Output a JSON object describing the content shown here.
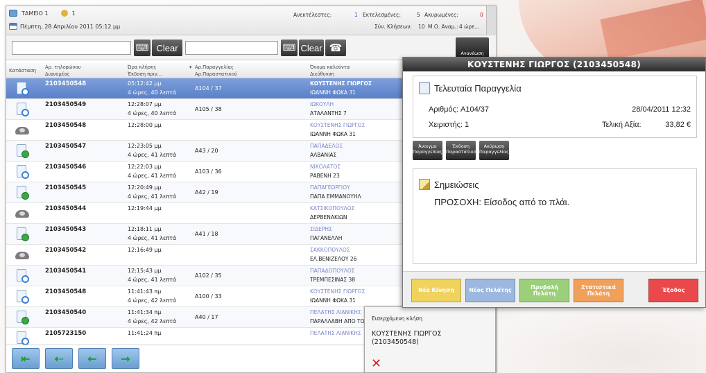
{
  "header": {
    "register": "ΤΑΜΕΙΟ 1",
    "user_count": "1",
    "datetime": "Πέμπτη, 28 Απριλίου 2011 05:12 μμ",
    "stats": {
      "pending_label": "Ανεκτέλεστες:",
      "executed_label": "Εκτελεσμένες:",
      "executed_value": "1",
      "cancelled_label": "Ακυρωμένες:",
      "cancelled_value": "5",
      "cancelled_extra": "0",
      "total_calls_label": "Σύν. Κλήσεων:",
      "total_calls_value": "10",
      "avg_label": "Μ.Ο. Αναμ.:",
      "avg_value": "4 ώρε..."
    }
  },
  "toolbar": {
    "search1_value": "",
    "clear1_label": "Clear",
    "search2_value": "",
    "clear2_label": "Clear",
    "refresh_label": "Ανανέωση"
  },
  "columns": {
    "status": "Κατάσταση",
    "phone": "Αρ. τηλεφώνου",
    "line": "Διανομέας",
    "call_time": "Ώρα κλήσης",
    "issue_time": "Έκδοση πριν...",
    "order_no": "Αρ.Παραγγελίας",
    "receipt_no": "Αρ.Παραστατικού",
    "caller_name": "Όνομα καλούντα",
    "address": "Διεύθυνση"
  },
  "calls": [
    {
      "status_icon": "order-pending-icon",
      "phone": "2103450548",
      "time": "05:12:42 μμ",
      "ago": "4 ώρες, 40 λεπτά",
      "order": "A104 / 37",
      "name": "ΚΟΥΣΤΕΝΗΣ ΓΙΩΡΓΟΣ",
      "address": "ΙΩΑΝΝΗ ΦΩΚΑ 31"
    },
    {
      "status_icon": "order-pending-icon",
      "phone": "2103450549",
      "time": "12:28:07 μμ",
      "ago": "4 ώρες, 40 λεπτά",
      "order": "A105 / 38",
      "name": "ΙΩΚΟΥΛΗ",
      "address": "ΑΤΑΛΑΝΤΗΣ 7"
    },
    {
      "status_icon": "telephone-icon",
      "phone": "2103450548",
      "time": "12:28:00 μμ",
      "ago": "",
      "order": "",
      "name": "ΚΟΥΣΤΕΝΗΣ ΓΙΩΡΓΟΣ",
      "address": "ΙΩΑΝΝΗ ΦΩΚΑ 31"
    },
    {
      "status_icon": "order-done-icon",
      "phone": "2103450547",
      "time": "12:23:05 μμ",
      "ago": "4 ώρες, 41 λεπτά",
      "order": "A43 / 20",
      "name": "ΠΑΠΑΔΕΛΟΣ",
      "address": "ΑΛΒΑΝΙΑΣ"
    },
    {
      "status_icon": "order-pending-icon",
      "phone": "2103450546",
      "time": "12:22:03 μμ",
      "ago": "4 ώρες, 41 λεπτά",
      "order": "A103 / 36",
      "name": "ΝΙΚΟΛΑΤΟΣ",
      "address": "ΡΑΒΕΝΗ 23"
    },
    {
      "status_icon": "order-done-icon",
      "phone": "2103450545",
      "time": "12:20:49 μμ",
      "ago": "4 ώρες, 41 λεπτά",
      "order": "A42 / 19",
      "name": "ΠΑΠΑΓΕΩΡΓΙΟΥ",
      "address": "ΠΑΠΑ ΕΜΜΑΝΟΥΗΛ"
    },
    {
      "status_icon": "telephone-icon",
      "phone": "2103450544",
      "time": "12:19:44 μμ",
      "ago": "",
      "order": "",
      "name": "ΚΑΤΣΙΚΟΠΟΥΛΟΣ",
      "address": "ΔΕΡΒΕΝΑΚΙΩΝ"
    },
    {
      "status_icon": "order-done-icon",
      "phone": "2103450543",
      "time": "12:18:11 μμ",
      "ago": "4 ώρες, 41 λεπτά",
      "order": "A41 / 18",
      "name": "ΣΙΔΕΡΗΣ",
      "address": "ΠΑΓΑΝΕΛΛΗ"
    },
    {
      "status_icon": "telephone-icon",
      "phone": "2103450542",
      "time": "12:16:49 μμ",
      "ago": "",
      "order": "",
      "name": "ΣΑΚΚΟΠΟΥΛΟΣ",
      "address": "ΕΛ.ΒΕΝΙΖΕΛΟΥ 26"
    },
    {
      "status_icon": "order-pending-icon",
      "phone": "2103450541",
      "time": "12:15:43 μμ",
      "ago": "4 ώρες, 41 λεπτά",
      "order": "A102 / 35",
      "name": "ΠΑΠΑΔΟΠΟΥΛΟΣ",
      "address": "ΤΡΕΜΠΕΣΙΝΑΣ 38"
    },
    {
      "status_icon": "order-pending-icon",
      "phone": "2103450548",
      "time": "11:41:43 πμ",
      "ago": "4 ώρες, 42 λεπτά",
      "order": "A100 / 33",
      "name": "ΚΟΥΣΤΕΝΗΣ ΓΙΩΡΓΟΣ",
      "address": "ΙΩΑΝΝΗ ΦΩΚΑ 31"
    },
    {
      "status_icon": "order-done-icon",
      "phone": "2103450540",
      "time": "11:41:34 πμ",
      "ago": "4 ώρες, 42 λεπτά",
      "order": "A40 / 17",
      "name": "ΠΕΛΑΤΗΣ ΛΙΑΝΙΚΗΣ",
      "address": "ΠΑΡΑΛΛΑΒΗ ΑΠΟ ΤΟ ..."
    },
    {
      "status_icon": "order-pending-icon",
      "phone": "2105723150",
      "time": "11:41:24 πμ",
      "ago": "",
      "order": "",
      "name": "ΠΕΛΑΤΗΣ ΛΙΑΝΙΚΗΣ",
      "address": ""
    }
  ],
  "incoming": {
    "title": "Εισερχόμενη κλήση",
    "caller": "ΚΟΥΣΤΕΝΗΣ ΓΙΩΡΓΟΣ",
    "phone": "(2103450548)"
  },
  "popup": {
    "title": "ΚΟΥΣΤΕΝΗΣ ΓΙΩΡΓΟΣ (2103450548)",
    "last_order_heading": "Τελευταία Παραγγελία",
    "order_number_label": "Αριθμός: A104/37",
    "order_datetime": "28/04/2011 12:32",
    "operator_label": "Χειριστής: 1",
    "total_label": "Τελική Αξία:",
    "total_value": "33,82 €",
    "actions": [
      "Άνοιγμα Παραγγελίας",
      "Έκδοση Παραστατικού",
      "Ακύρωση Παραγγελίας"
    ],
    "notes_heading": "Σημειώσεις",
    "notes_text": "ΠΡΟΣΟΧΗ: Είσοδος από το πλάι.",
    "buttons": {
      "new_move": "Νέα Κίνηση",
      "new_customer": "Νέος Πελάτης",
      "view_customer": "Προβολή Πελάτη",
      "stats_customer": "Στατιστικά Πελάτη",
      "exit": "Έξοδος"
    },
    "colors": {
      "new_move": "#f0d35c",
      "new_customer": "#9cb8de",
      "view_customer": "#9bcf79",
      "stats_customer": "#f1a05a",
      "exit": "#e9494a"
    }
  }
}
